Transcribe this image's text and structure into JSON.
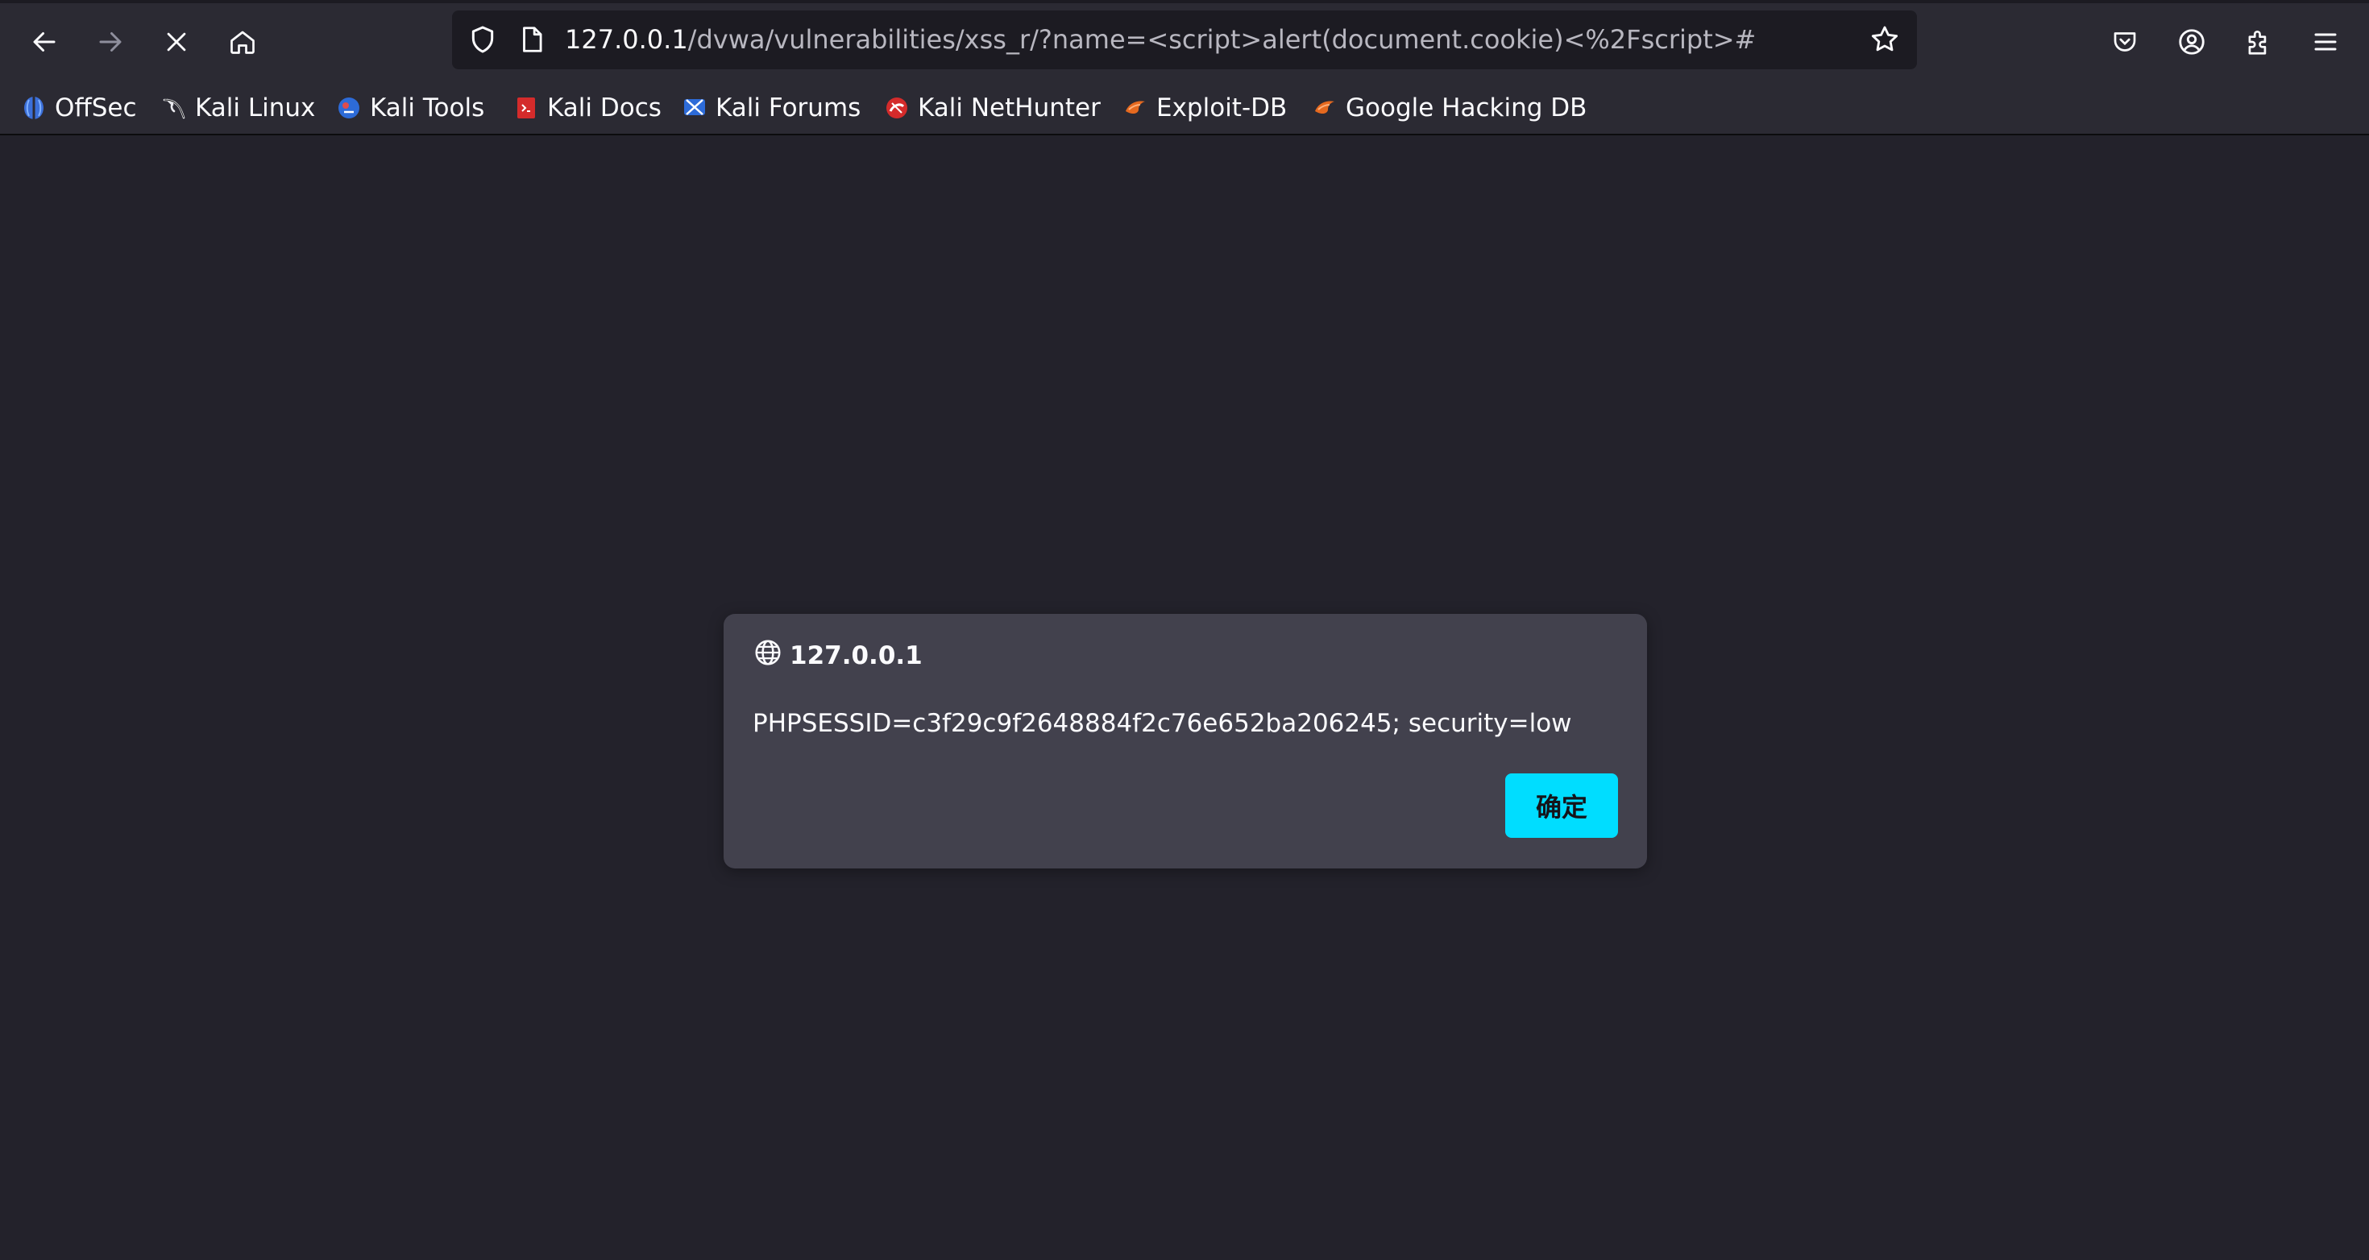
{
  "urlbar": {
    "host": "127.0.0.1",
    "path": "/dvwa/vulnerabilities/xss_r/?name=<script>alert(document.cookie)<%2Fscript>#"
  },
  "bookmarks": [
    {
      "label": "OffSec",
      "icon": "offsec-icon",
      "color": "#3b6fd9"
    },
    {
      "label": "Kali Linux",
      "icon": "kali-dragon-icon",
      "color": "#111111"
    },
    {
      "label": "Kali Tools",
      "icon": "kali-tools-icon",
      "color": "#2d6bd8"
    },
    {
      "label": "Kali Docs",
      "icon": "kali-docs-icon",
      "color": "#d42b2b"
    },
    {
      "label": "Kali Forums",
      "icon": "kali-forums-icon",
      "color": "#2d6bd8"
    },
    {
      "label": "Kali NetHunter",
      "icon": "nethunter-icon",
      "color": "#d42b2b"
    },
    {
      "label": "Exploit-DB",
      "icon": "exploit-db-icon",
      "color": "#e5691f"
    },
    {
      "label": "Google Hacking DB",
      "icon": "ghdb-icon",
      "color": "#e5691f"
    }
  ],
  "dialog": {
    "origin": "127.0.0.1",
    "message": "PHPSESSID=c3f29c9f2648884f2c76e652ba206245; security=low",
    "ok_label": "确定"
  },
  "colors": {
    "toolbar": "#2b2a33",
    "urlbar": "#1c1b22",
    "page": "#23222b",
    "dialog": "#42414d",
    "accent": "#00ddff"
  }
}
